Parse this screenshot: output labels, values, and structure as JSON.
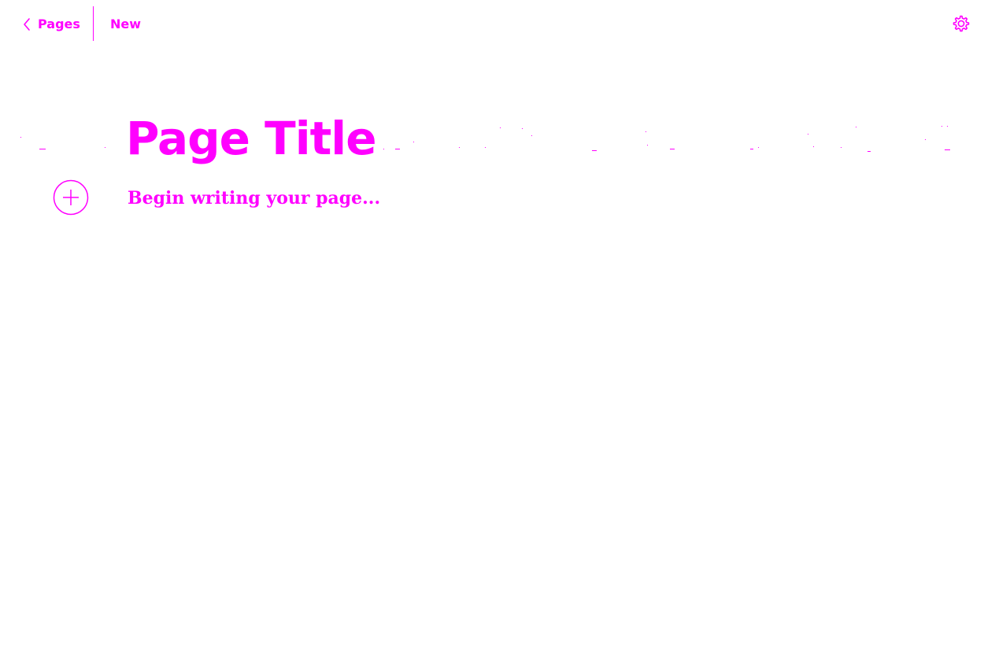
{
  "theme": {
    "accent": "#ff00ff",
    "background": "#ffffff"
  },
  "nav": {
    "back_icon": "chevron-left-icon",
    "back_label": "Pages",
    "current_label": "New",
    "settings_icon": "gear-icon"
  },
  "page": {
    "title": "Page Title",
    "body_placeholder": "Begin writing your page...",
    "add_block_icon": "plus-circle-icon"
  }
}
